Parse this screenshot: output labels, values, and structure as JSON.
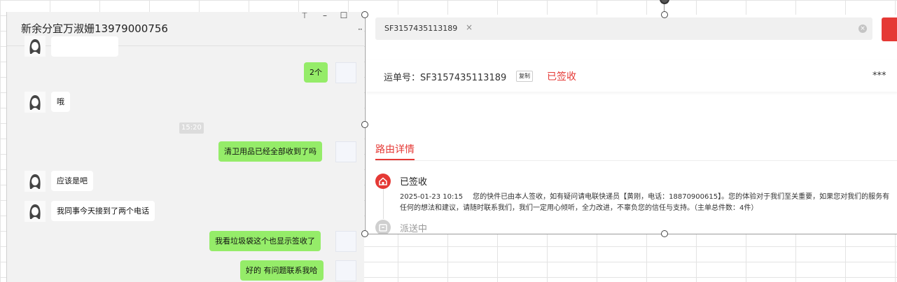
{
  "chat": {
    "title": "新余分宜万淑姗13979000756",
    "controls": {
      "pin": "⍑",
      "minimize": "–",
      "maximize": "☐",
      "more": "··"
    },
    "time_chip": "15:20",
    "messages": [
      {
        "side": "left",
        "text": "哦"
      },
      {
        "side": "right",
        "text": "2个"
      },
      {
        "side": "right",
        "text": "清卫用品已经全部收到了吗"
      },
      {
        "side": "left",
        "text": "应该是吧"
      },
      {
        "side": "left",
        "text": "我同事今天接到了两个电话"
      },
      {
        "side": "right",
        "text": "我看垃圾袋这个也显示签收了"
      },
      {
        "side": "right",
        "text": "好的 有问题联系我哈"
      }
    ]
  },
  "tracking": {
    "search_tag": "SF3157435113189",
    "tag_close": "×",
    "clear": "×",
    "waybill_label": "运单号：SF3157435113189",
    "copy_label": "复制",
    "status": "已签收",
    "masked": "***",
    "tab_label": "路由详情",
    "events": [
      {
        "title": "已签收",
        "time": "2025-01-23 10:15",
        "description": "您的快件已由本人签收，如有疑问请电联快递员【黄刚，电话：18870900615】。您的体验对于我们至关重要，如果您对我们的服务有任何的想法和建议，请随时联系我们，我们一定用心倾听，全力改进，不辜负您的信任与支持。（主单总件数：4件）"
      },
      {
        "title": "派送中"
      }
    ]
  },
  "colors": {
    "accent_red": "#e53935",
    "bubble_green": "#95ec69"
  }
}
